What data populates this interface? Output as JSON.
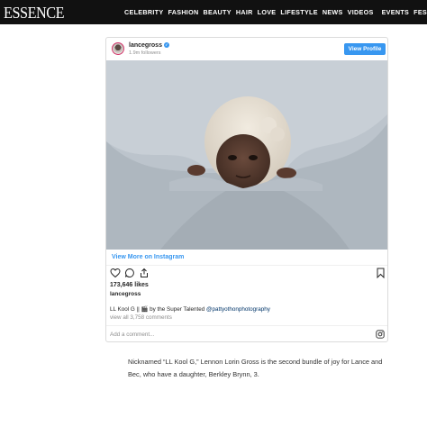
{
  "nav": {
    "logo": "ESSENCE",
    "links": [
      "CELEBRITY",
      "FASHION",
      "BEAUTY",
      "HAIR",
      "LOVE",
      "LIFESTYLE",
      "NEWS",
      "VIDEOS",
      "EVENTS",
      "FESTIVAL"
    ]
  },
  "embed": {
    "username": "lancegross",
    "followers": "1.9m followers",
    "view_profile": "View Profile",
    "view_more": "View More on Instagram",
    "likes": "173,646 likes",
    "author": "lancegross",
    "caption_prefix": "LL Kool G ||",
    "caption_emoji": "🎬",
    "caption_middle": "by the Super Talented",
    "caption_mention": "@pattyothonphotography",
    "comments_link": "view all 3,758 comments",
    "add_comment": "Add a comment..."
  },
  "icons": {
    "like": "heart-icon",
    "comment": "comment-icon",
    "share": "share-icon",
    "save": "bookmark-icon",
    "instagram": "instagram-icon",
    "verified": "verified-badge-icon"
  },
  "colors": {
    "nav_bg": "#111111",
    "accent_blue": "#3897f0",
    "photo_blanket": "#b9c1c9"
  },
  "article": {
    "paragraph": "Nicknamed “LL Kool G,” Lennon Lorin Gross is the second bundle of joy for Lance and Bec, who have a daughter, Berkley Brynn, 3."
  }
}
